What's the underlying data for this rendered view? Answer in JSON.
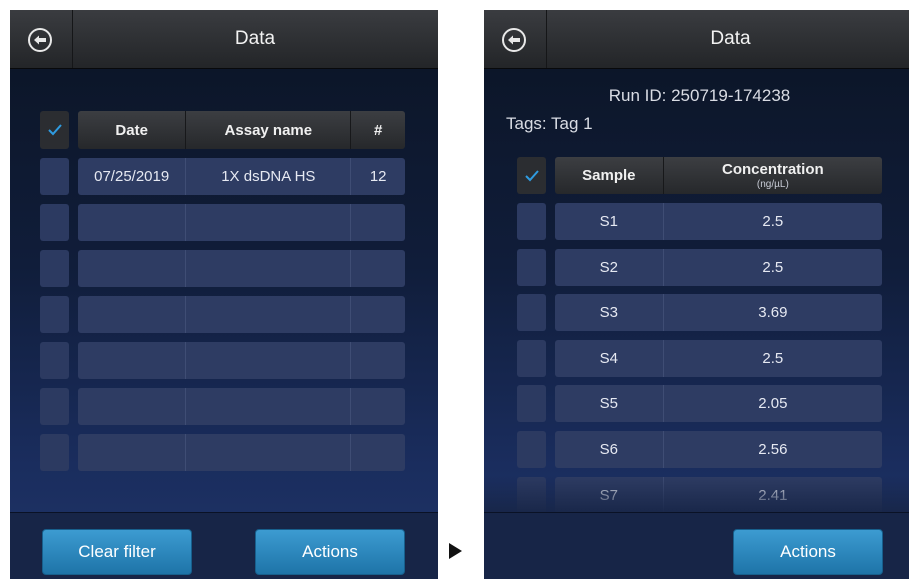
{
  "left_screen": {
    "title": "Data",
    "table": {
      "headers": [
        "Date",
        "Assay name",
        "#"
      ],
      "rows": [
        [
          "07/25/2019",
          "1X dsDNA HS",
          "12"
        ],
        [
          "",
          "",
          ""
        ],
        [
          "",
          "",
          ""
        ],
        [
          "",
          "",
          ""
        ],
        [
          "",
          "",
          ""
        ],
        [
          "",
          "",
          ""
        ],
        [
          "",
          "",
          ""
        ]
      ]
    },
    "buttons": {
      "clear_filter": "Clear filter",
      "actions": "Actions"
    }
  },
  "right_screen": {
    "title": "Data",
    "run_id": "Run ID: 250719-174238",
    "tags": "Tags: Tag 1",
    "table": {
      "headers": [
        "Sample",
        "Concentration"
      ],
      "unit": "(ng/µL)",
      "rows": [
        [
          "S1",
          "2.5"
        ],
        [
          "S2",
          "2.5"
        ],
        [
          "S3",
          "3.69"
        ],
        [
          "S4",
          "2.5"
        ],
        [
          "S5",
          "2.05"
        ],
        [
          "S6",
          "2.56"
        ],
        [
          "S7",
          "2.41"
        ]
      ]
    },
    "buttons": {
      "actions": "Actions"
    }
  },
  "colors": {
    "accent": "#2a8ac4",
    "check": "#2f9be0",
    "row": "#2e3c63",
    "header": "#2b2d31"
  },
  "icons": [
    "back-arrow-icon",
    "checkmark-icon",
    "next-arrow-icon"
  ]
}
